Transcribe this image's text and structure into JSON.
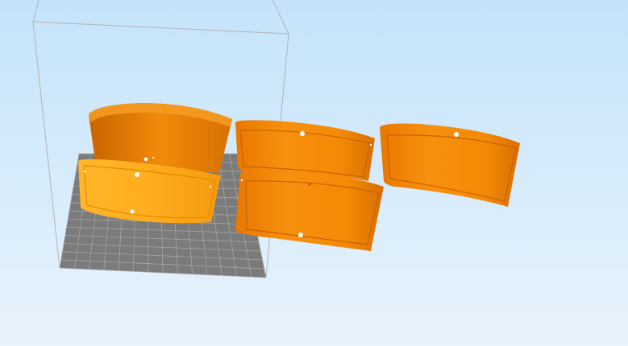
{
  "viewport": {
    "background_top": "#c4e3fa",
    "background_bottom": "#e8f3fc"
  },
  "build_volume": {
    "frame_color": "#b4b4b4",
    "plate_color": "#7b7b7b",
    "grid_color": "#a9a9a9",
    "grid_divisions": 14
  },
  "objects": [
    {
      "name": "curved-panel-back-left",
      "color": "#f48a06"
    },
    {
      "name": "curved-panel-front-left",
      "color": "#ffab1f",
      "state": "selected"
    },
    {
      "name": "curved-panel-back-middle",
      "color": "#f48a06"
    },
    {
      "name": "curved-panel-front-middle",
      "color": "#f48a06"
    },
    {
      "name": "curved-panel-right",
      "color": "#f48a06"
    }
  ]
}
